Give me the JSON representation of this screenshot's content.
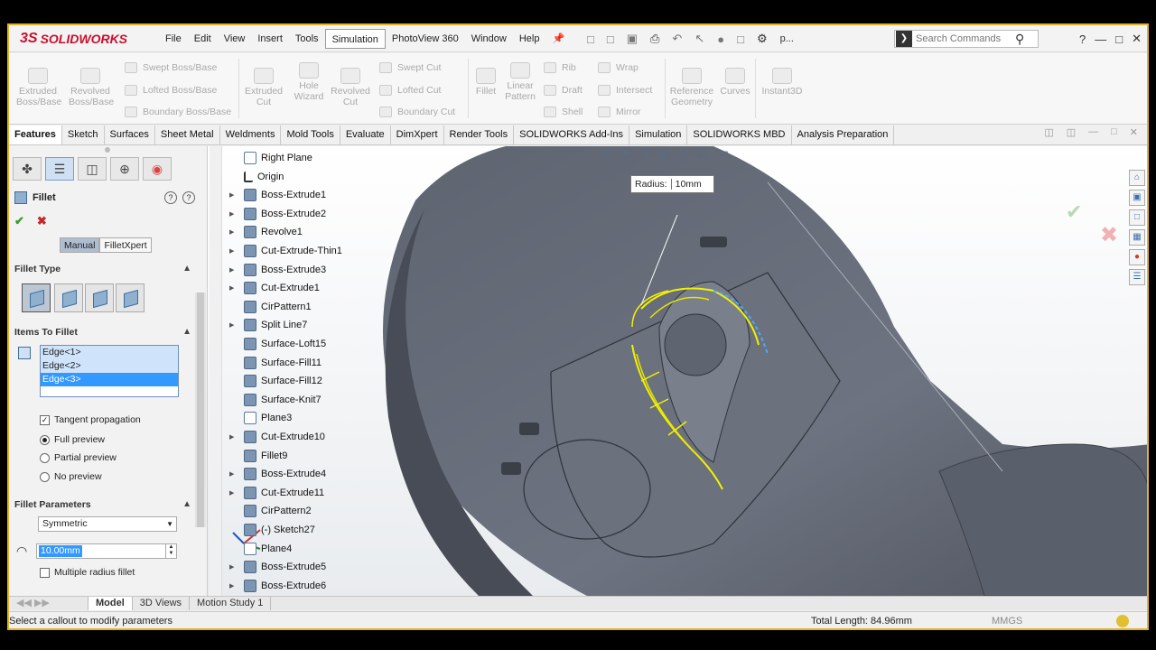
{
  "app": {
    "brand": "SOLIDWORKS",
    "logo_text": "3S"
  },
  "menu": [
    "File",
    "Edit",
    "View",
    "Insert",
    "Tools",
    "Simulation",
    "PhotoView 360",
    "Window",
    "Help"
  ],
  "menu_active": "Simulation",
  "search": {
    "placeholder": "Search Commands",
    "partial": "p..."
  },
  "command_manager": {
    "extruded_boss": "Extruded Boss/Base",
    "revolved_boss": "Revolved Boss/Base",
    "swept_boss": "Swept Boss/Base",
    "lofted_boss": "Lofted Boss/Base",
    "boundary_boss": "Boundary Boss/Base",
    "extruded_cut": "Extruded Cut",
    "hole_wizard": "Hole Wizard",
    "revolved_cut": "Revolved Cut",
    "swept_cut": "Swept Cut",
    "lofted_cut": "Lofted Cut",
    "boundary_cut": "Boundary Cut",
    "fillet": "Fillet",
    "linear_pattern": "Linear Pattern",
    "rib": "Rib",
    "draft": "Draft",
    "shell": "Shell",
    "wrap": "Wrap",
    "intersect": "Intersect",
    "mirror": "Mirror",
    "reference_geometry": "Reference Geometry",
    "curves": "Curves",
    "instant3d": "Instant3D"
  },
  "cmd_tabs": [
    "Features",
    "Sketch",
    "Surfaces",
    "Sheet Metal",
    "Weldments",
    "Mold Tools",
    "Evaluate",
    "DimXpert",
    "Render Tools",
    "SOLIDWORKS Add-Ins",
    "Simulation",
    "SOLIDWORKS MBD",
    "Analysis Preparation"
  ],
  "property_manager": {
    "title": "Fillet",
    "mode_manual": "Manual",
    "mode_filletxpert": "FilletXpert",
    "fillet_type_header": "Fillet Type",
    "items_header": "Items To Fillet",
    "edges": [
      "Edge<1>",
      "Edge<2>",
      "Edge<3>"
    ],
    "tangent_propagation": "Tangent propagation",
    "full_preview": "Full preview",
    "partial_preview": "Partial preview",
    "no_preview": "No preview",
    "params_header": "Fillet Parameters",
    "symmetric": "Symmetric",
    "radius_value": "10.00mm",
    "multiple_radius": "Multiple radius fillet"
  },
  "tree": [
    "Right Plane",
    "Origin",
    "Boss-Extrude1",
    "Boss-Extrude2",
    "Revolve1",
    "Cut-Extrude-Thin1",
    "Boss-Extrude3",
    "Cut-Extrude1",
    "CirPattern1",
    "Split Line7",
    "Surface-Loft15",
    "Surface-Fill11",
    "Surface-Fill12",
    "Surface-Knit7",
    "Plane3",
    "Cut-Extrude10",
    "Fillet9",
    "Boss-Extrude4",
    "Cut-Extrude11",
    "CirPattern2",
    "(-) Sketch27",
    "Plane4",
    "Boss-Extrude5",
    "Boss-Extrude6"
  ],
  "callout": {
    "label": "Radius:",
    "value": "10mm"
  },
  "bottom_tabs": [
    "Model",
    "3D Views",
    "Motion Study 1"
  ],
  "status": {
    "message": "Select a callout to modify parameters",
    "total_length": "Total Length: 84.96mm",
    "units": "MMGS"
  }
}
